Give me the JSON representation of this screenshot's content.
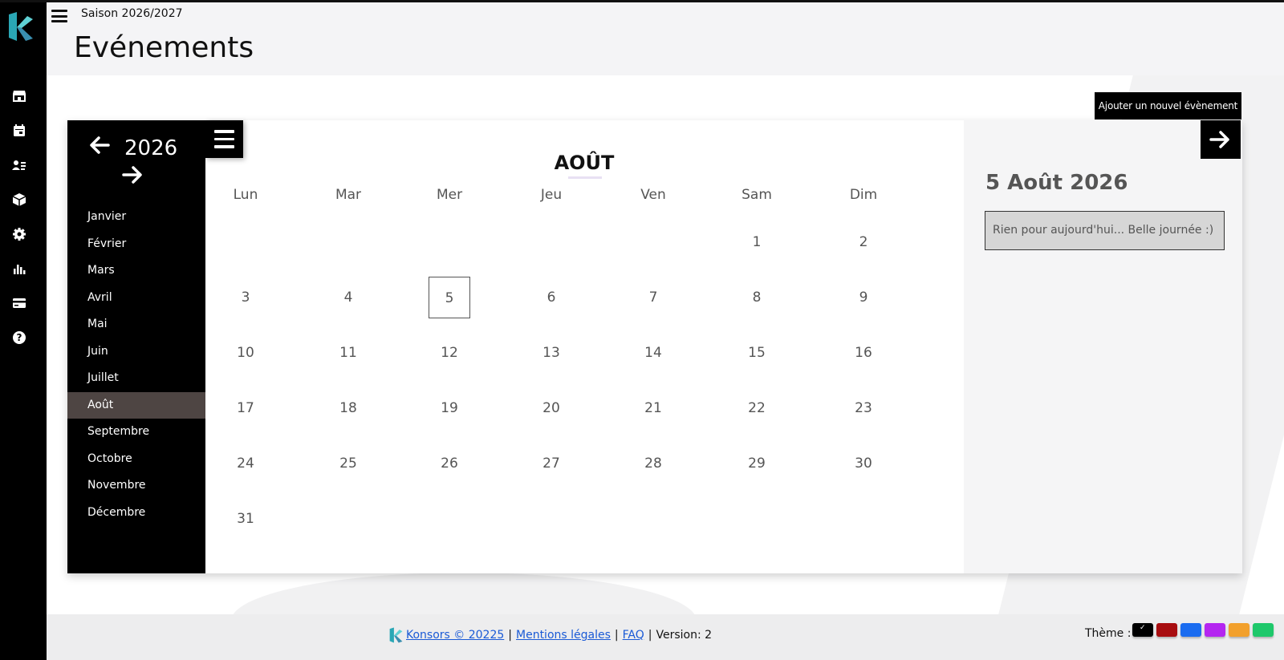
{
  "header": {
    "season": "Saison 2026/2027",
    "title": "Evénements"
  },
  "toolbar": {
    "add_event_label": "Ajouter un nouvel évènement"
  },
  "sidebar_icons": [
    "store-icon",
    "calendar-icon",
    "contacts-icon",
    "box-icon",
    "gear-icon",
    "bar-chart-icon",
    "credit-card-icon",
    "help-icon"
  ],
  "calendar": {
    "year": "2026",
    "month_title": "AOÛT",
    "months": [
      "Janvier",
      "Février",
      "Mars",
      "Avril",
      "Mai",
      "Juin",
      "Juillet",
      "Août",
      "Septembre",
      "Octobre",
      "Novembre",
      "Décembre"
    ],
    "active_month": "Août",
    "weekdays": [
      "Lun",
      "Mar",
      "Mer",
      "Jeu",
      "Ven",
      "Sam",
      "Dim"
    ],
    "first_weekday_index": 5,
    "days_in_month": 31,
    "selected_day": 5
  },
  "detail": {
    "date": "5 Août 2026",
    "message": "Rien pour aujourd'hui... Belle journée :)"
  },
  "footer": {
    "brand_link": "Konsors © 20225",
    "sep": "|",
    "legal_link": "Mentions légales",
    "faq_link": "FAQ",
    "version": "Version: 2",
    "theme_label": "Thème :",
    "theme_check": "✓",
    "themes": [
      {
        "name": "black",
        "color": "#000000",
        "selected": true
      },
      {
        "name": "red",
        "color": "#a80d10",
        "selected": false
      },
      {
        "name": "blue",
        "color": "#1a6cf0",
        "selected": false
      },
      {
        "name": "purple",
        "color": "#b426f0",
        "selected": false
      },
      {
        "name": "orange",
        "color": "#f2a02c",
        "selected": false
      },
      {
        "name": "green",
        "color": "#1ec86b",
        "selected": false
      }
    ]
  },
  "colors": {
    "accent": "#000000",
    "active_month_bg": "#4e4543",
    "logo_teal": "#3ec3c3"
  }
}
